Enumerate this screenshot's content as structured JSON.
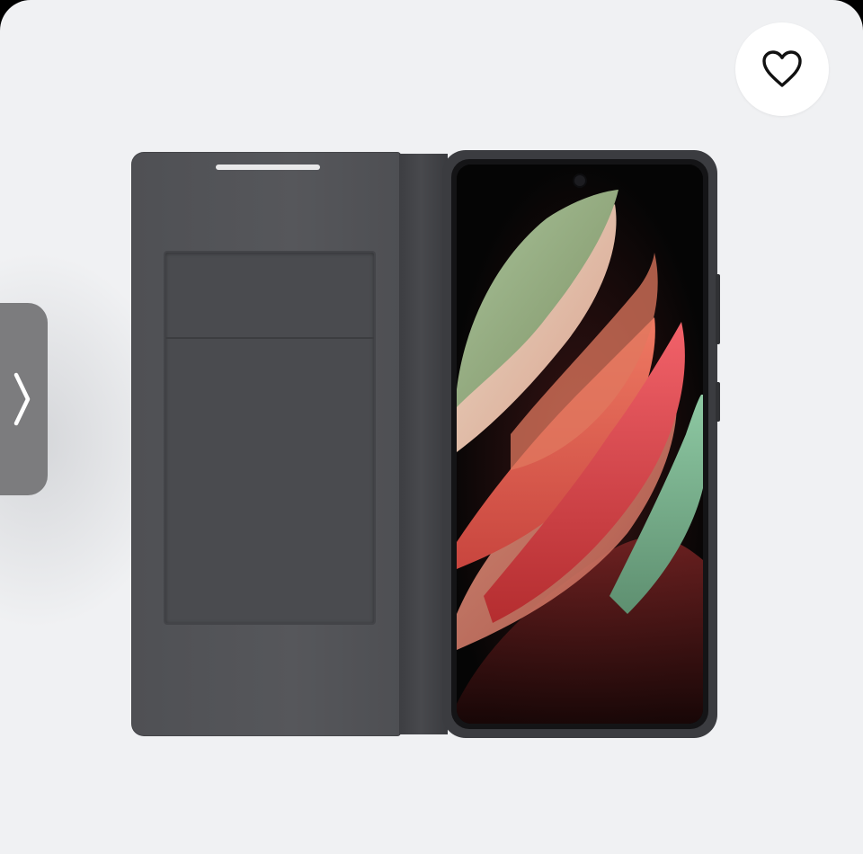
{
  "product_image": {
    "alt": "",
    "background": "#f0f1f3"
  },
  "favorite_button": {
    "icon": "heart-outline-icon"
  },
  "next_button": {
    "icon": "chevron-right-icon"
  },
  "colors": {
    "case": "#4f5054",
    "slide_button": "#7c7c7e",
    "petal_green": "#8fb59a",
    "petal_coral": "#e5645f",
    "petal_red": "#d63b3b"
  }
}
